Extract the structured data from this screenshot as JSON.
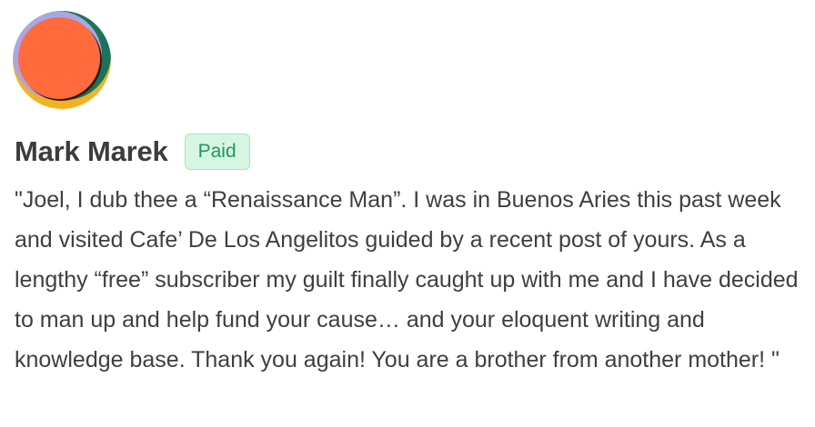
{
  "testimonial": {
    "author_name": "Mark Marek",
    "badge_label": "Paid",
    "quote": "\"Joel, I dub thee a “Renaissance Man”. I was in Buenos Aries this past week and visited Cafe’ De Los Angelitos guided by a recent post of yours. As a lengthy “free” subscriber my guilt finally caught up with me and I have decided to man up and help fund your cause… and your eloquent writing and knowledge base. Thank you again! You are a brother from another mother! \"",
    "avatar_icon": "abstract-avatar-icon"
  },
  "colors": {
    "badge_bg": "#d8f5e4",
    "badge_text": "#1a9a5b",
    "avatar_orange": "#ff6b3d",
    "avatar_green": "#16755a",
    "avatar_yellow": "#f4b223",
    "avatar_lavender": "#a9a6e6"
  }
}
